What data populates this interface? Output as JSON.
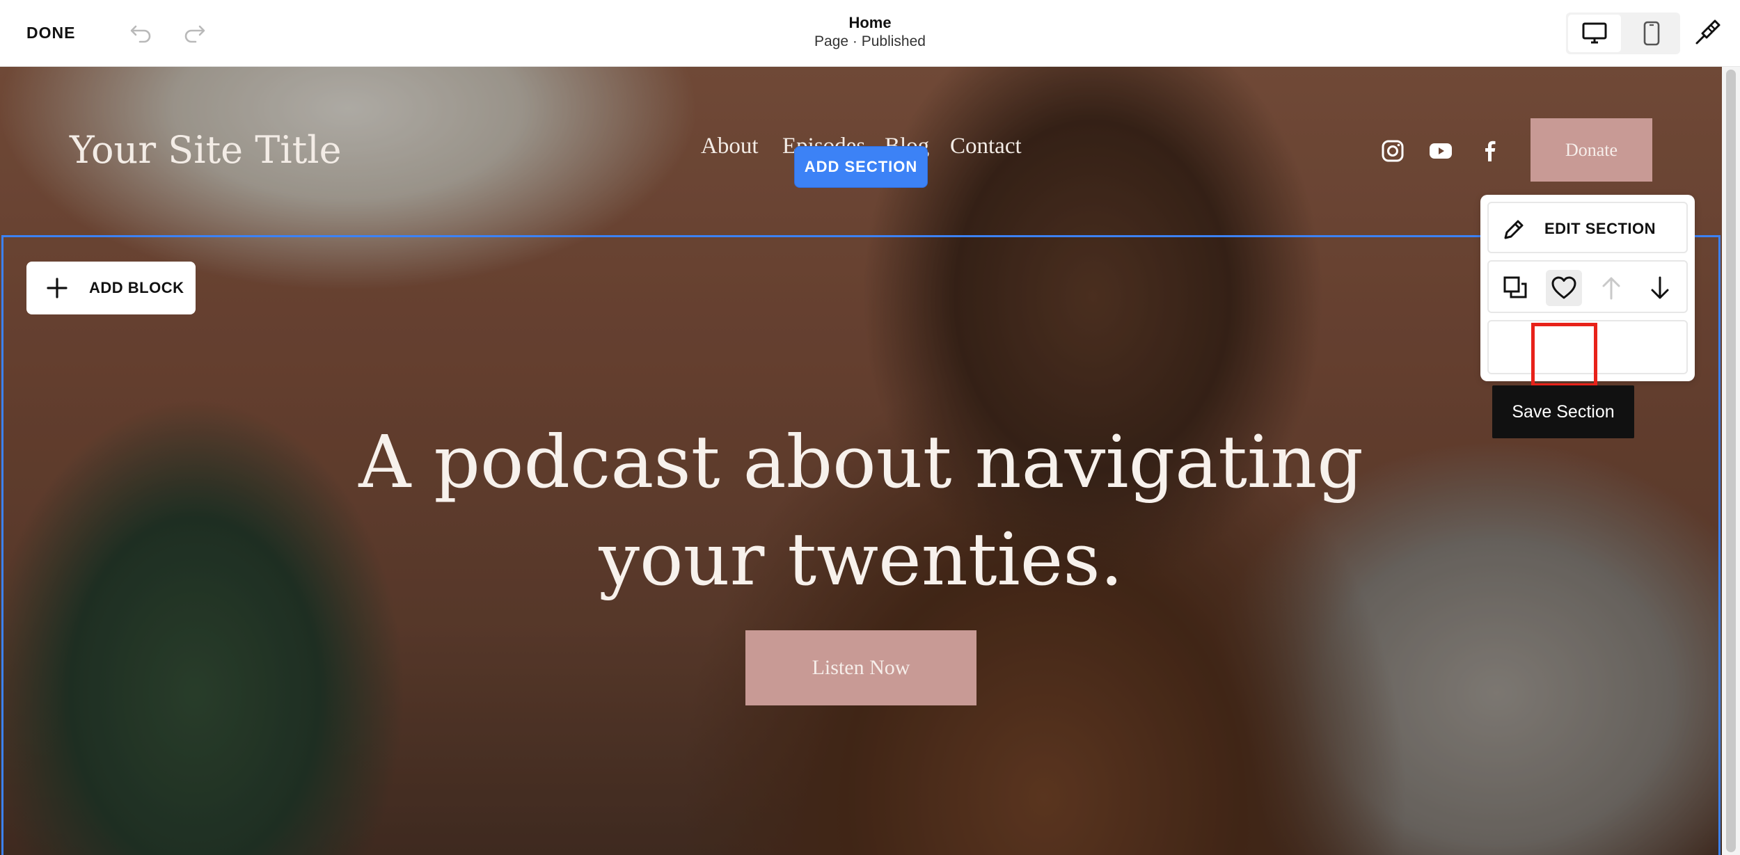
{
  "editor": {
    "done_label": "DONE",
    "page_title": "Home",
    "page_status": "Page · Published",
    "undo_icon": "undo-icon",
    "redo_icon": "redo-icon",
    "device_options": [
      "desktop",
      "mobile"
    ],
    "selected_device": "desktop",
    "design_icon": "paintbrush-icon"
  },
  "site": {
    "title": "Your Site Title",
    "nav": [
      "About",
      "Episodes",
      "Blog",
      "Contact"
    ],
    "social": [
      "instagram-icon",
      "youtube-icon",
      "facebook-icon"
    ],
    "donate_label": "Donate"
  },
  "hero": {
    "headline_line1": "A podcast about navigating",
    "headline_line2": "your twenties.",
    "cta_label": "Listen Now"
  },
  "section_controls": {
    "add_section_label": "ADD SECTION",
    "add_block_label": "ADD BLOCK",
    "edit_section_label": "EDIT SECTION",
    "tooltip": "Save Section",
    "tools": [
      "duplicate-icon",
      "heart-icon",
      "arrow-up-icon",
      "arrow-down-icon"
    ]
  },
  "colors": {
    "accent": "#3c82f6",
    "button_rose": "#c89a95",
    "highlight": "#e8221a"
  }
}
